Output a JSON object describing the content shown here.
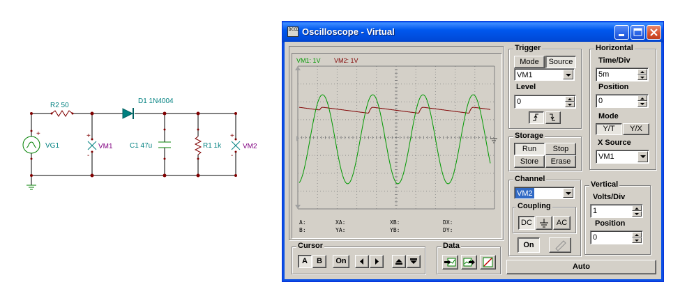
{
  "schematic": {
    "r2_label": "R2 50",
    "d1_label": "D1 1N4004",
    "vg1_label": "VG1",
    "vm1_label": "VM1",
    "c1_label": "C1 47u",
    "r1_label": "R1 1k",
    "vm2_label": "VM2",
    "plus": "+",
    "minus": "-"
  },
  "window": {
    "title": "Oscilloscope - Virtual",
    "icon_text": "DCCD"
  },
  "display": {
    "vm1_label": "VM1: 1V",
    "vm2_label": "VM2: 1V",
    "colors": {
      "vm1": "#009900",
      "vm2": "#800000",
      "grid": "#808080"
    },
    "cursor": {
      "a": "A:",
      "b": "B:",
      "xa": "XA:",
      "ya": "YA:",
      "xb": "XB:",
      "yb": "YB:",
      "dx": "DX:",
      "dy": "DY:"
    }
  },
  "trigger": {
    "title": "Trigger",
    "mode_label": "Mode",
    "source_label": "Source",
    "source_value": "VM1",
    "level_label": "Level",
    "level_value": "0",
    "rising_icon": "rising-edge-icon",
    "falling_icon": "falling-edge-icon"
  },
  "horizontal": {
    "title": "Horizontal",
    "time_div_label": "Time/Div",
    "time_div_value": "5m",
    "position_label": "Position",
    "position_value": "0",
    "mode_label": "Mode",
    "mode_yt": "Y/T",
    "mode_yx": "Y/X",
    "x_source_label": "X Source",
    "x_source_value": "VM1"
  },
  "storage": {
    "title": "Storage",
    "run": "Run",
    "stop": "Stop",
    "store": "Store",
    "erase": "Erase"
  },
  "channel": {
    "title": "Channel",
    "value": "VM2",
    "coupling_title": "Coupling",
    "dc": "DC",
    "ac": "AC",
    "on": "On"
  },
  "vertical": {
    "title": "Vertical",
    "volts_div_label": "Volts/Div",
    "volts_div_value": "1",
    "position_label": "Position",
    "position_value": "0"
  },
  "cursor_group": {
    "title": "Cursor",
    "a": "A",
    "b": "B",
    "on": "On"
  },
  "data_group": {
    "title": "Data"
  },
  "auto_button": "Auto"
}
